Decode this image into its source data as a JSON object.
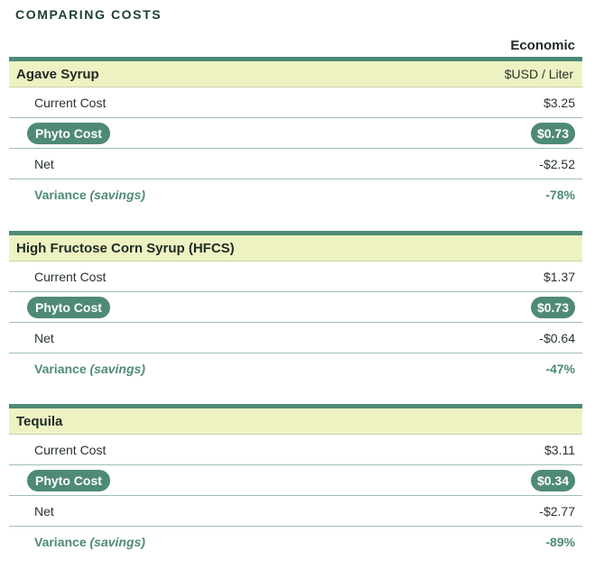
{
  "title": "COMPARING COSTS",
  "column_header": "Economic",
  "sections": [
    {
      "name": "Agave Syrup",
      "unit": "$USD / Liter",
      "current_cost_label": "Current Cost",
      "current_cost": "$3.25",
      "phyto_cost_label": "Phyto Cost",
      "phyto_cost": "$0.73",
      "net_label": "Net",
      "net": "-$2.52",
      "variance_label": "Variance",
      "variance_note": "(savings)",
      "variance": "-78%"
    },
    {
      "name": "High Fructose Corn Syrup (HFCS)",
      "unit": "",
      "current_cost_label": "Current Cost",
      "current_cost": "$1.37",
      "phyto_cost_label": "Phyto Cost",
      "phyto_cost": "$0.73",
      "net_label": "Net",
      "net": "-$0.64",
      "variance_label": "Variance",
      "variance_note": "(savings)",
      "variance": "-47%"
    },
    {
      "name": "Tequila",
      "unit": "",
      "current_cost_label": "Current Cost",
      "current_cost": "$3.11",
      "phyto_cost_label": "Phyto Cost",
      "phyto_cost": "$0.34",
      "net_label": "Net",
      "net": "-$2.77",
      "variance_label": "Variance",
      "variance_note": "(savings)",
      "variance": "-89%"
    }
  ],
  "colors": {
    "accent": "#4e8a76",
    "header_band": "#eef2c3",
    "title": "#1f3d33"
  }
}
